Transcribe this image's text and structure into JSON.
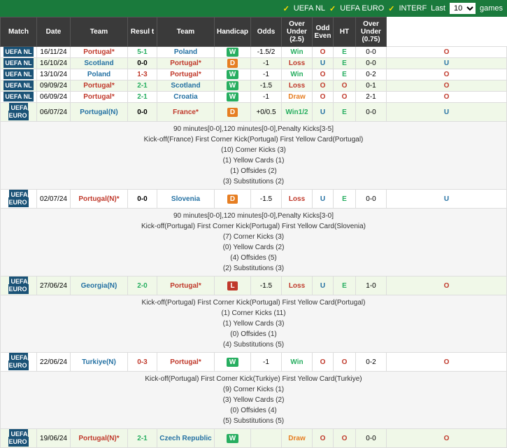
{
  "header": {
    "filters": [
      "UEFA NL",
      "UEFA EURO",
      "INTERF"
    ],
    "last_label": "Last",
    "games_label": "games",
    "games_value": "10"
  },
  "columns": {
    "match": "Match",
    "date": "Date",
    "team1": "Team",
    "result": "Result",
    "team2": "Team",
    "handicap": "Handicap",
    "odds": "Odds",
    "over_under": "Over Under (2.5)",
    "odd_even": "Odd Even",
    "ht": "HT",
    "over075": "Over Under (0.75)"
  },
  "rows": [
    {
      "type": "match",
      "competition": "UEFA NL",
      "date": "16/11/24",
      "team1": "Portugal*",
      "team1_color": "red",
      "result": "5-1",
      "result_color": "green",
      "team2": "Poland",
      "team2_color": "blue",
      "wdl": "W",
      "handicap": "-1.5/2",
      "odds": "Win",
      "over_under": "O",
      "odd_even": "E",
      "ht": "0-0",
      "over075": "O",
      "alt": false
    },
    {
      "type": "match",
      "competition": "UEFA NL",
      "date": "16/10/24",
      "team1": "Scotland",
      "team1_color": "blue",
      "result": "0-0",
      "result_color": "black",
      "team2": "Portugal*",
      "team2_color": "red",
      "wdl": "D",
      "handicap": "-1",
      "odds": "Loss",
      "over_under": "U",
      "odd_even": "E",
      "ht": "0-0",
      "over075": "U",
      "alt": true
    },
    {
      "type": "match",
      "competition": "UEFA NL",
      "date": "13/10/24",
      "team1": "Poland",
      "team1_color": "blue",
      "result": "1-3",
      "result_color": "red",
      "team2": "Portugal*",
      "team2_color": "red",
      "wdl": "W",
      "handicap": "-1",
      "odds": "Win",
      "over_under": "O",
      "odd_even": "E",
      "ht": "0-2",
      "over075": "O",
      "alt": false
    },
    {
      "type": "match",
      "competition": "UEFA NL",
      "date": "09/09/24",
      "team1": "Portugal*",
      "team1_color": "red",
      "result": "2-1",
      "result_color": "green",
      "team2": "Scotland",
      "team2_color": "blue",
      "wdl": "W",
      "handicap": "-1.5",
      "odds": "Loss",
      "over_under": "O",
      "odd_even": "O",
      "ht": "0-1",
      "over075": "O",
      "alt": true
    },
    {
      "type": "match",
      "competition": "UEFA NL",
      "date": "06/09/24",
      "team1": "Portugal*",
      "team1_color": "red",
      "result": "2-1",
      "result_color": "green",
      "team2": "Croatia",
      "team2_color": "blue",
      "wdl": "W",
      "handicap": "-1",
      "odds": "Draw",
      "over_under": "O",
      "odd_even": "O",
      "ht": "2-1",
      "over075": "O",
      "alt": false
    },
    {
      "type": "match",
      "competition": "UEFA EURO",
      "date": "06/07/24",
      "team1": "Portugal(N)",
      "team1_color": "blue",
      "result": "0-0",
      "result_color": "black",
      "team2": "France*",
      "team2_color": "red",
      "wdl": "D",
      "handicap": "+0/0.5",
      "odds": "Win1/2",
      "over_under": "U",
      "odd_even": "E",
      "ht": "0-0",
      "over075": "U",
      "alt": true
    },
    {
      "type": "detail",
      "text": "90 minutes[0-0],120 minutes[0-0],Penalty Kicks[3-5]\nKick-off(France)  First Corner Kick(Portugal)  First Yellow Card(Portugal)\n(10) Corner Kicks (3)\n(1) Yellow Cards (1)\n(1) Offsides (2)\n(3) Substitutions (2)"
    },
    {
      "type": "match",
      "competition": "UEFA EURO",
      "date": "02/07/24",
      "team1": "Portugal(N)*",
      "team1_color": "red",
      "result": "0-0",
      "result_color": "black",
      "team2": "Slovenia",
      "team2_color": "blue",
      "wdl": "D",
      "handicap": "-1.5",
      "odds": "Loss",
      "over_under": "U",
      "odd_even": "E",
      "ht": "0-0",
      "over075": "U",
      "alt": false
    },
    {
      "type": "detail",
      "text": "90 minutes[0-0],120 minutes[0-0],Penalty Kicks[3-0]\nKick-off(Portugal)  First Corner Kick(Portugal)  First Yellow Card(Slovenia)\n(7) Corner Kicks (3)\n(0) Yellow Cards (2)\n(4) Offsides (5)\n(2) Substitutions (3)"
    },
    {
      "type": "match",
      "competition": "UEFA EURO",
      "date": "27/06/24",
      "team1": "Georgia(N)",
      "team1_color": "blue",
      "result": "2-0",
      "result_color": "green",
      "team2": "Portugal*",
      "team2_color": "red",
      "wdl": "L",
      "handicap": "-1.5",
      "odds": "Loss",
      "over_under": "U",
      "odd_even": "E",
      "ht": "1-0",
      "over075": "O",
      "alt": true
    },
    {
      "type": "detail",
      "text": "Kick-off(Portugal)  First Corner Kick(Portugal)  First Yellow Card(Portugal)\n(1) Corner Kicks (11)\n(1) Yellow Cards (3)\n(0) Offsides (1)\n(4) Substitutions (5)"
    },
    {
      "type": "match",
      "competition": "UEFA EURO",
      "date": "22/06/24",
      "team1": "Turkiye(N)",
      "team1_color": "blue",
      "result": "0-3",
      "result_color": "red",
      "team2": "Portugal*",
      "team2_color": "red",
      "wdl": "W",
      "handicap": "-1",
      "odds": "Win",
      "over_under": "O",
      "odd_even": "O",
      "ht": "0-2",
      "over075": "O",
      "alt": false
    },
    {
      "type": "detail",
      "text": "Kick-off(Portugal)  First Corner Kick(Turkiye)  First Yellow Card(Turkiye)\n(9) Corner Kicks (1)\n(3) Yellow Cards (2)\n(0) Offsides (4)\n(5) Substitutions (5)"
    },
    {
      "type": "match",
      "competition": "UEFA EURO",
      "date": "19/06/24",
      "team1": "Portugal(N)*",
      "team1_color": "red",
      "result": "2-1",
      "result_color": "green",
      "team2": "Czech Republic",
      "team2_color": "blue",
      "wdl": "W",
      "handicap": "",
      "odds": "Draw",
      "over_under": "O",
      "odd_even": "O",
      "ht": "0-0",
      "over075": "O",
      "alt": true
    }
  ]
}
